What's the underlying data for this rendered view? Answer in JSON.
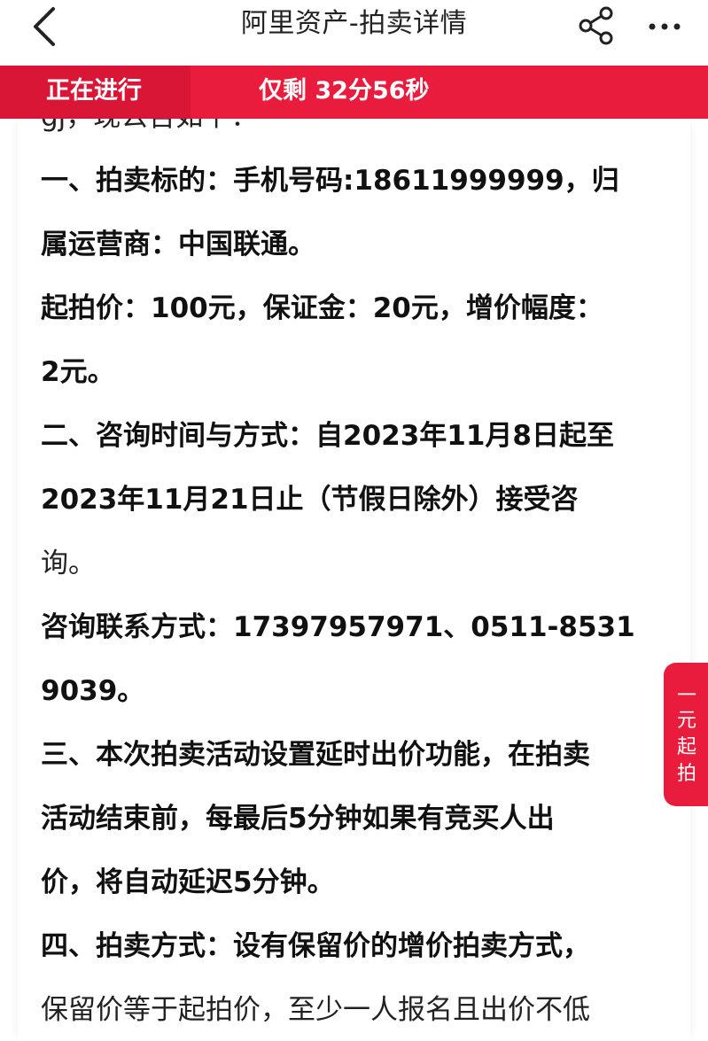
{
  "nav": {
    "title": "阿里资产-拍卖详情",
    "back_icon": "chevron-left-icon",
    "share_icon": "share-icon",
    "more_icon": "more-icon"
  },
  "status": {
    "state": "正在进行",
    "countdown": "仅剩 32分56秒"
  },
  "content": {
    "lines": [
      "gj，现公告如下：",
      "一、拍卖标的：手机号码:18611999999，归",
      "属运营商：中国联通。",
      "起拍价：100元，保证金：20元，增价幅度：",
      "2元。",
      "二、咨询时间与方式：自2023年11月8日起至",
      "2023年11月21日止（节假日除外）接受咨",
      "询。",
      "咨询联系方式：17397957971、0511-8531",
      "9039。",
      "三、本次拍卖活动设置延时出价功能，在拍卖",
      "活动结束前，每最后5分钟如果有竞买人出",
      "价，将自动延迟5分钟。",
      "四、拍卖方式：设有保留价的增价拍卖方式，",
      "保留价等于起拍价，至少一人报名且出价不低"
    ]
  },
  "side_button": {
    "chars": [
      "一",
      "元",
      "起",
      "拍"
    ]
  },
  "colors": {
    "brand_red": "#ea1c3d",
    "tab_red": "#d91635"
  }
}
